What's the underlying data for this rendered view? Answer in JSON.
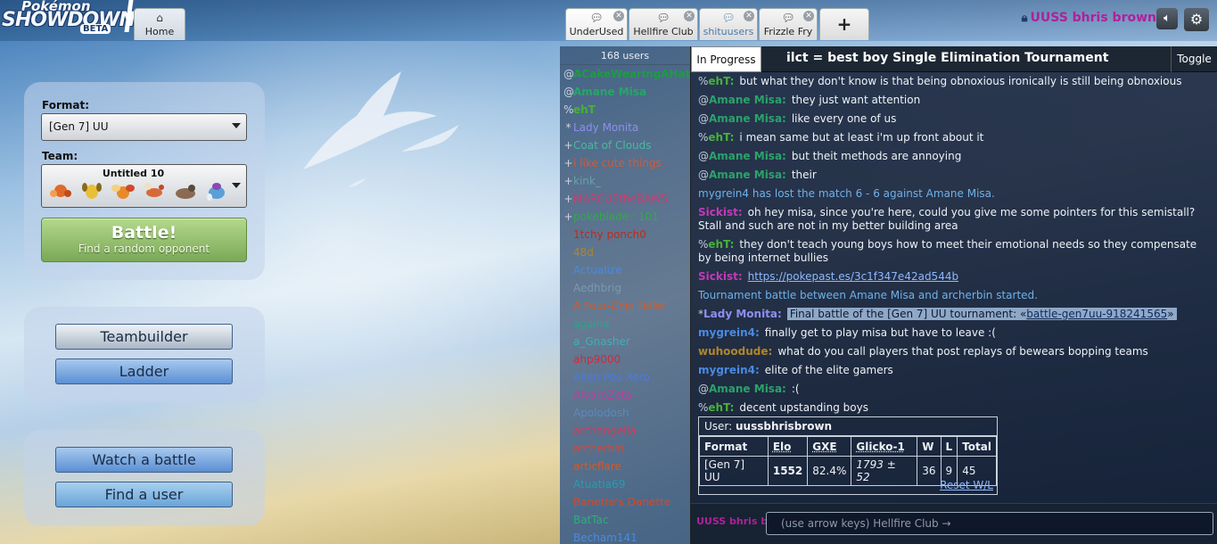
{
  "logo": {
    "line1": "Pokémon",
    "line2": "SHOWDOWN",
    "badge": "BETA"
  },
  "tabs": {
    "home": "Home",
    "rooms": [
      {
        "label": "UnderUsed",
        "icon": "chat-bubble-icon"
      },
      {
        "label": "Hellfire Club",
        "icon": "chat-bubble-icon"
      },
      {
        "label": "shituusers",
        "icon": "chat-bubbles-icon"
      },
      {
        "label": "Frizzle Fry",
        "icon": "chat-bubble-icon"
      }
    ],
    "new_tab": "+"
  },
  "user": {
    "name": "UUSS bhris brown"
  },
  "home": {
    "format_label": "Format:",
    "format_value": "[Gen 7] UU",
    "team_label": "Team:",
    "team_name": "Untitled 10",
    "battle_label": "Battle!",
    "battle_sub": "Find a random opponent",
    "teambuilder": "Teambuilder",
    "ladder": "Ladder",
    "watch": "Watch a battle",
    "find_user": "Find a user"
  },
  "userlist": {
    "count": "168 users",
    "users": [
      {
        "rank": "@",
        "name": "ACakeWearingAHat",
        "color": "#1f9a45",
        "bold": true
      },
      {
        "rank": "@",
        "name": "Amane Misa",
        "color": "#2aa36a",
        "bold": true
      },
      {
        "rank": "%",
        "name": "ehT",
        "color": "#46b23a",
        "bold": true
      },
      {
        "rank": "*",
        "name": "Lady Monita",
        "color": "#8d8ff0",
        "bold": false
      },
      {
        "rank": "+",
        "name": "Coat of Clouds",
        "color": "#49b8a0",
        "bold": false
      },
      {
        "rank": "+",
        "name": "i like cute things",
        "color": "#d15a3a",
        "bold": false
      },
      {
        "rank": "+",
        "name": "kink_",
        "color": "#6aa0a8",
        "bold": false
      },
      {
        "rank": "+",
        "name": "MARCU5theBAW5",
        "color": "#d03a6a",
        "bold": false
      },
      {
        "rank": "+",
        "name": "pokeblade☆101",
        "color": "#32a84a",
        "bold": false
      },
      {
        "rank": "",
        "name": "1tchy ponch0",
        "color": "#c02a1a",
        "bold": false
      },
      {
        "rank": "",
        "name": "48d",
        "color": "#b0862a",
        "bold": false
      },
      {
        "rank": "",
        "name": "Actualize",
        "color": "#4a8ae0",
        "bold": false
      },
      {
        "rank": "",
        "name": "Aedhbrig",
        "color": "#7a98b0",
        "bold": false
      },
      {
        "rank": "",
        "name": "A Four-Chin Teller",
        "color": "#d45a2a",
        "bold": false
      },
      {
        "rank": "",
        "name": "againa",
        "color": "#2aa38a",
        "bold": false
      },
      {
        "rank": "",
        "name": "a_Gnasher",
        "color": "#3ab0b8",
        "bold": false
      },
      {
        "rank": "",
        "name": "ahp9000",
        "color": "#d02a3a",
        "bold": false
      },
      {
        "rank": "",
        "name": "Allen Poe Xero",
        "color": "#4a7ae0",
        "bold": false
      },
      {
        "rank": "",
        "name": "AlvaroZeta",
        "color": "#c03aa0",
        "bold": false
      },
      {
        "rank": "",
        "name": "Apolodosh",
        "color": "#5a8ab8",
        "bold": false
      },
      {
        "rank": "",
        "name": "archangelia",
        "color": "#d03a5a",
        "bold": false
      },
      {
        "rank": "",
        "name": "archerbin",
        "color": "#d04a3a",
        "bold": false
      },
      {
        "rank": "",
        "name": "articflare",
        "color": "#d05a2a",
        "bold": false
      },
      {
        "rank": "",
        "name": "Atuatia69",
        "color": "#2a9ab0",
        "bold": false
      },
      {
        "rank": "",
        "name": "Banette's Danette",
        "color": "#d04a2a",
        "bold": false
      },
      {
        "rank": "",
        "name": "BatTac",
        "color": "#2ab07a",
        "bold": false
      },
      {
        "rank": "",
        "name": "Becham141",
        "color": "#4a8ae0",
        "bold": false
      }
    ]
  },
  "tour": {
    "status": "In Progress",
    "title": "ilct = best boy Single Elimination Tournament",
    "toggle": "Toggle"
  },
  "chat": [
    {
      "type": "msg",
      "rank": "%",
      "name": "ehT:",
      "color": "#46b23a",
      "text": "but what they don't know is that being obnoxious ironically is still being obnoxious"
    },
    {
      "type": "msg",
      "rank": "@",
      "name": "Amane Misa:",
      "color": "#2aa36a",
      "text": "they just want attention"
    },
    {
      "type": "msg",
      "rank": "@",
      "name": "Amane Misa:",
      "color": "#2aa36a",
      "text": "like every one of us"
    },
    {
      "type": "msg",
      "rank": "%",
      "name": "ehT:",
      "color": "#46b23a",
      "text": "i mean same but at least i'm up front about it"
    },
    {
      "type": "msg",
      "rank": "@",
      "name": "Amane Misa:",
      "color": "#2aa36a",
      "text": "but theit methods are annoying"
    },
    {
      "type": "msg",
      "rank": "@",
      "name": "Amane Misa:",
      "color": "#2aa36a",
      "text": "their"
    },
    {
      "type": "notice",
      "text": "mygrein4 has lost the match 6 - 6 against Amane Misa."
    },
    {
      "type": "msg",
      "rank": "",
      "name": "Sickist:",
      "color": "#c03ab8",
      "text": "oh hey misa, since you're here, could you give me some pointers for this semistall? Stall and such are not in my better building area"
    },
    {
      "type": "msg",
      "rank": "%",
      "name": "ehT:",
      "color": "#46b23a",
      "text": "they don't teach young boys how to meet their emotional needs so they compensate by being internet bullies"
    },
    {
      "type": "link",
      "rank": "",
      "name": "Sickist:",
      "color": "#c03ab8",
      "link": "https://pokepast.es/3c1f347e42ad544b"
    },
    {
      "type": "notice",
      "text": "Tournament battle between Amane Misa and archerbin started."
    },
    {
      "type": "highlight",
      "rank": "*",
      "name": "Lady Monita:",
      "color": "#8d8ff0",
      "pre": "Final battle of the [Gen 7] UU tournament: «",
      "link": "battle-gen7uu-918241565",
      "post": "»"
    },
    {
      "type": "msg",
      "rank": "",
      "name": "mygrein4:",
      "color": "#4a8ae0",
      "text": "finally get to play misa but have to leave :("
    },
    {
      "type": "msg",
      "rank": "",
      "name": "wuhoodude:",
      "color": "#b0862a",
      "text": "what do you call players that post replays of bewears bopping teams"
    },
    {
      "type": "msg",
      "rank": "",
      "name": "mygrein4:",
      "color": "#4a8ae0",
      "text": "elite of the elite gamers"
    },
    {
      "type": "msg",
      "rank": "@",
      "name": "Amane Misa:",
      "color": "#2aa36a",
      "text": ":("
    },
    {
      "type": "msg",
      "rank": "%",
      "name": "ehT:",
      "color": "#46b23a",
      "text": "decent upstanding boys"
    }
  ],
  "stats": {
    "user_label": "User:",
    "user_name": "uussbhrisbrown",
    "headers": [
      "Format",
      "Elo",
      "GXE",
      "Glicko-1",
      "W",
      "L",
      "Total"
    ],
    "row": [
      "[Gen 7] UU",
      "1552",
      "82.4%",
      "1793 ± 52",
      "36",
      "9",
      "45"
    ],
    "reset": "Reset W/L"
  },
  "input": {
    "me": "UUSS bhris b",
    "placeholder": "(use arrow keys) Hellfire Club →"
  }
}
